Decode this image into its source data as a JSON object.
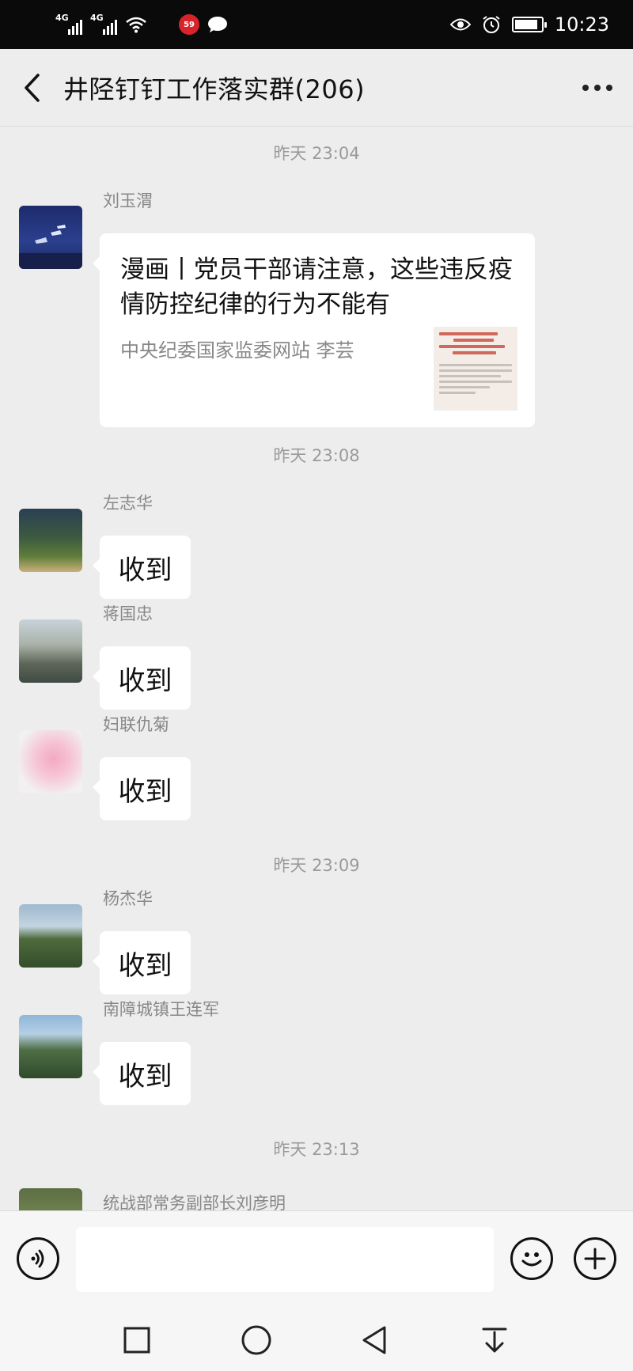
{
  "status_bar": {
    "signal1_label": "4G",
    "signal2_label": "4G",
    "notif_badge": "59",
    "time": "10:23"
  },
  "header": {
    "title": "井陉钉钉工作落实群(206)"
  },
  "messages": {
    "ts1": "昨天 23:04",
    "ts2": "昨天 23:08",
    "ts3": "昨天 23:09",
    "ts4": "昨天 23:13",
    "m1": {
      "sender": "刘玉渭",
      "card_title": "漫画丨党员干部请注意，这些违反疫情防控纪律的行为不能有",
      "card_source": "中央纪委国家监委网站 李芸"
    },
    "m2": {
      "sender": "左志华",
      "text": "收到"
    },
    "m3": {
      "sender": "蒋国忠",
      "text": "收到"
    },
    "m4": {
      "sender": "妇联仇菊",
      "text": "收到"
    },
    "m5": {
      "sender": "杨杰华",
      "text": "收到"
    },
    "m6": {
      "sender": "南障城镇王连军",
      "text": "收到"
    },
    "m7": {
      "sender": "统战部常务副部长刘彦明"
    }
  },
  "input_bar": {
    "value": "",
    "icons": [
      "voice-icon",
      "emoji-icon",
      "plus-icon"
    ]
  },
  "nav_bar": {
    "icons": [
      "recents-icon",
      "home-icon",
      "back-icon",
      "notification-pull-icon"
    ]
  },
  "colors": {
    "background": "#ededed",
    "bubble": "#ffffff",
    "status_bar": "#0a0a0a",
    "badge": "#d8232a"
  }
}
